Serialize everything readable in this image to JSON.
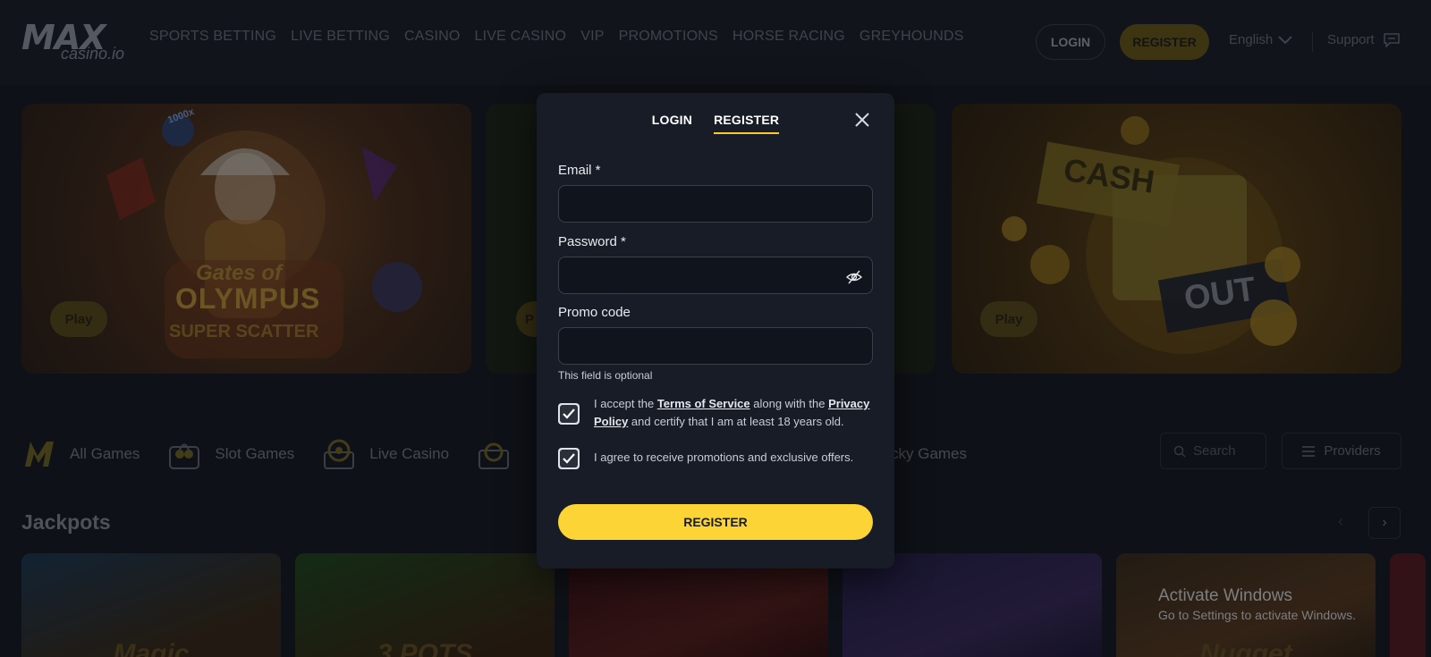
{
  "header": {
    "logo_main": "MAX",
    "logo_sub": "casino.io",
    "nav": [
      "SPORTS BETTING",
      "LIVE BETTING",
      "CASINO",
      "LIVE CASINO",
      "VIP",
      "PROMOTIONS",
      "HORSE RACING",
      "GREYHOUNDS"
    ],
    "login_label": "LOGIN",
    "register_label": "REGISTER",
    "language": "English",
    "support": "Support"
  },
  "banners": {
    "play_label": "Play",
    "play_partial": "P",
    "banner1_art_line1": "Gates of",
    "banner1_art_line2": "OLYMPUS",
    "banner1_art_line3": "SUPER SCATTER",
    "banner1_badge": "1000x",
    "banner3_art_top": "CASH",
    "banner3_art_bottom": "OUT"
  },
  "categories": {
    "items": [
      "All Games",
      "Slot Games",
      "Live Casino"
    ],
    "lucky_partial": "cky Games",
    "search_placeholder": "Search",
    "providers_label": "Providers"
  },
  "jackpots": {
    "title": "Jackpots",
    "tile_labels": [
      "Magic",
      "3 POTS",
      "",
      "",
      "Nugget"
    ]
  },
  "modal": {
    "tabs": [
      "LOGIN",
      "REGISTER"
    ],
    "active_tab": "REGISTER",
    "email_label": "Email *",
    "password_label": "Password *",
    "promo_label": "Promo code",
    "email_value": "",
    "password_value": "",
    "promo_value": "",
    "promo_hint": "This field is optional",
    "terms_prefix": "I accept the ",
    "terms_link": "Terms of Service",
    "terms_middle": " along with the ",
    "privacy_link": "Privacy Policy",
    "terms_suffix": " and certify that I am at least 18 years old.",
    "terms_checked": true,
    "promo_consent": "I agree to receive promotions and exclusive offers.",
    "promo_checked": true,
    "submit_label": "REGISTER"
  },
  "watermark": {
    "line1": "Activate Windows",
    "line2": "Go to Settings to activate Windows."
  },
  "colors": {
    "accent": "#fcd435",
    "modal_bg": "#171c26",
    "page_bg": "#14171f"
  }
}
